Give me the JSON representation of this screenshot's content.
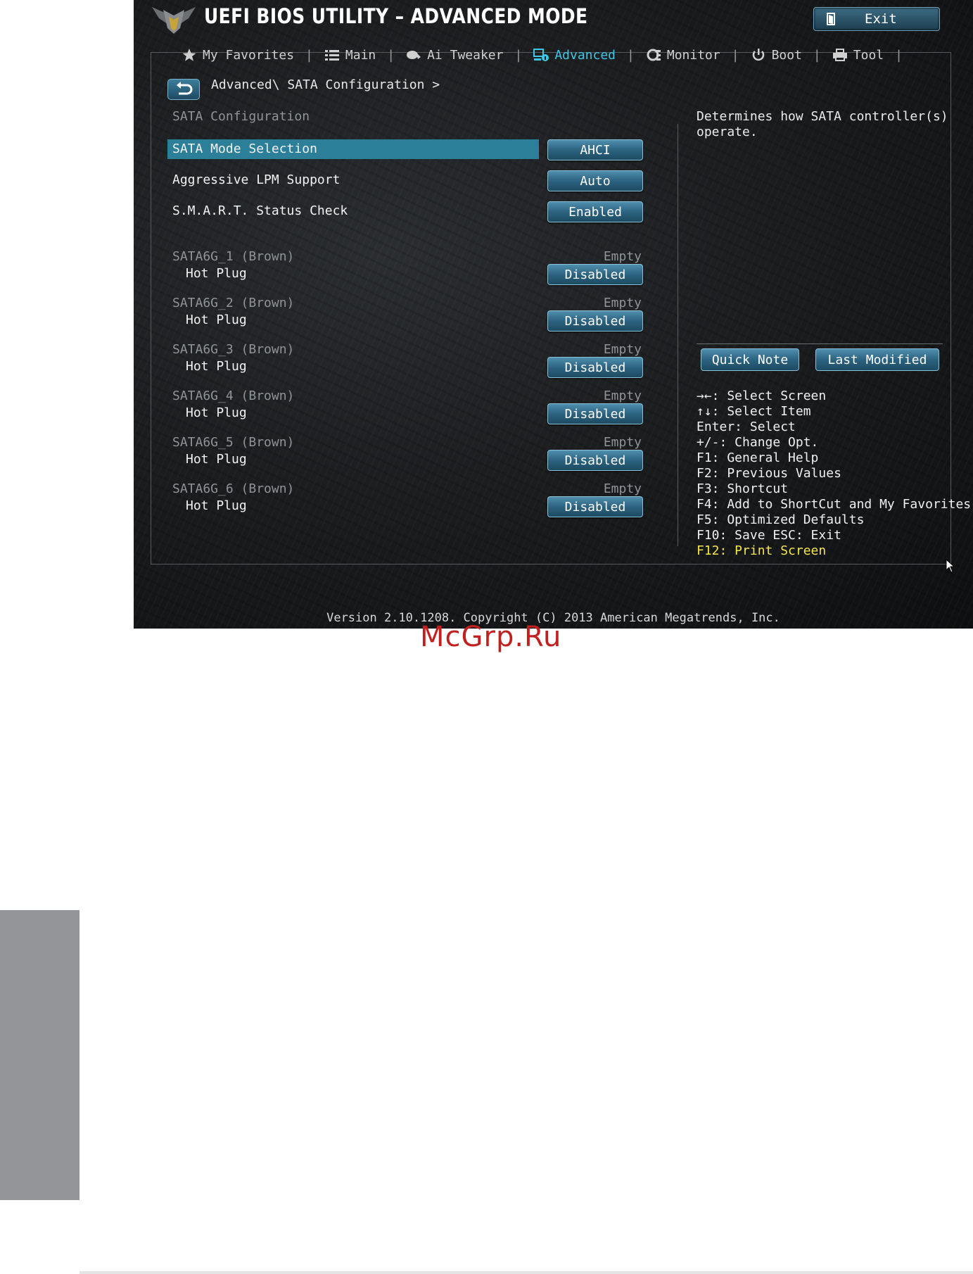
{
  "header": {
    "title": "UEFI BIOS UTILITY – ADVANCED MODE",
    "exit_label": "Exit"
  },
  "tabs": [
    {
      "label": "My Favorites",
      "icon": "star-icon"
    },
    {
      "label": "Main",
      "icon": "list-icon"
    },
    {
      "label": "Ai Tweaker",
      "icon": "tweaker-icon"
    },
    {
      "label": "Advanced",
      "icon": "advanced-icon",
      "active": true
    },
    {
      "label": "Monitor",
      "icon": "monitor-icon"
    },
    {
      "label": "Boot",
      "icon": "power-icon"
    },
    {
      "label": "Tool",
      "icon": "printer-icon"
    }
  ],
  "breadcrumb": "Advanced\\ SATA Configuration >",
  "section_title": "SATA Configuration",
  "settings": [
    {
      "label": "SATA Mode Selection",
      "value": "AHCI"
    },
    {
      "label": "Aggressive LPM Support",
      "value": "Auto"
    },
    {
      "label": "S.M.A.R.T. Status Check",
      "value": "Enabled"
    }
  ],
  "ports": [
    {
      "name": "SATA6G_1 (Brown)",
      "status": "Empty",
      "hotplug_label": "Hot Plug",
      "hotplug_value": "Disabled"
    },
    {
      "name": "SATA6G_2 (Brown)",
      "status": "Empty",
      "hotplug_label": "Hot Plug",
      "hotplug_value": "Disabled"
    },
    {
      "name": "SATA6G_3 (Brown)",
      "status": "Empty",
      "hotplug_label": "Hot Plug",
      "hotplug_value": "Disabled"
    },
    {
      "name": "SATA6G_4 (Brown)",
      "status": "Empty",
      "hotplug_label": "Hot Plug",
      "hotplug_value": "Disabled"
    },
    {
      "name": "SATA6G_5 (Brown)",
      "status": "Empty",
      "hotplug_label": "Hot Plug",
      "hotplug_value": "Disabled"
    },
    {
      "name": "SATA6G_6 (Brown)",
      "status": "Empty",
      "hotplug_label": "Hot Plug",
      "hotplug_value": "Disabled"
    }
  ],
  "help": {
    "description": "Determines how SATA controller(s) operate.",
    "quick_note": "Quick Note",
    "last_modified": "Last Modified",
    "keys": [
      "→←: Select Screen",
      "↑↓: Select Item",
      "Enter: Select",
      "+/-: Change Opt.",
      "F1: General Help",
      "F2: Previous Values",
      "F3: Shortcut",
      "F4: Add to ShortCut and My Favorites",
      "F5: Optimized Defaults",
      "F10: Save  ESC: Exit"
    ],
    "highlight_key": "F12: Print Screen"
  },
  "footer": {
    "version": "Version 2.10.1208. Copyright (C) 2013 American Megatrends, Inc."
  },
  "watermark": "McGrp.Ru",
  "colors": {
    "accent": "#3cc7e8",
    "selection": "#2c7f98",
    "highlight_key": "#f5e64a",
    "watermark": "#c2201f",
    "side_tab": "#939598"
  }
}
